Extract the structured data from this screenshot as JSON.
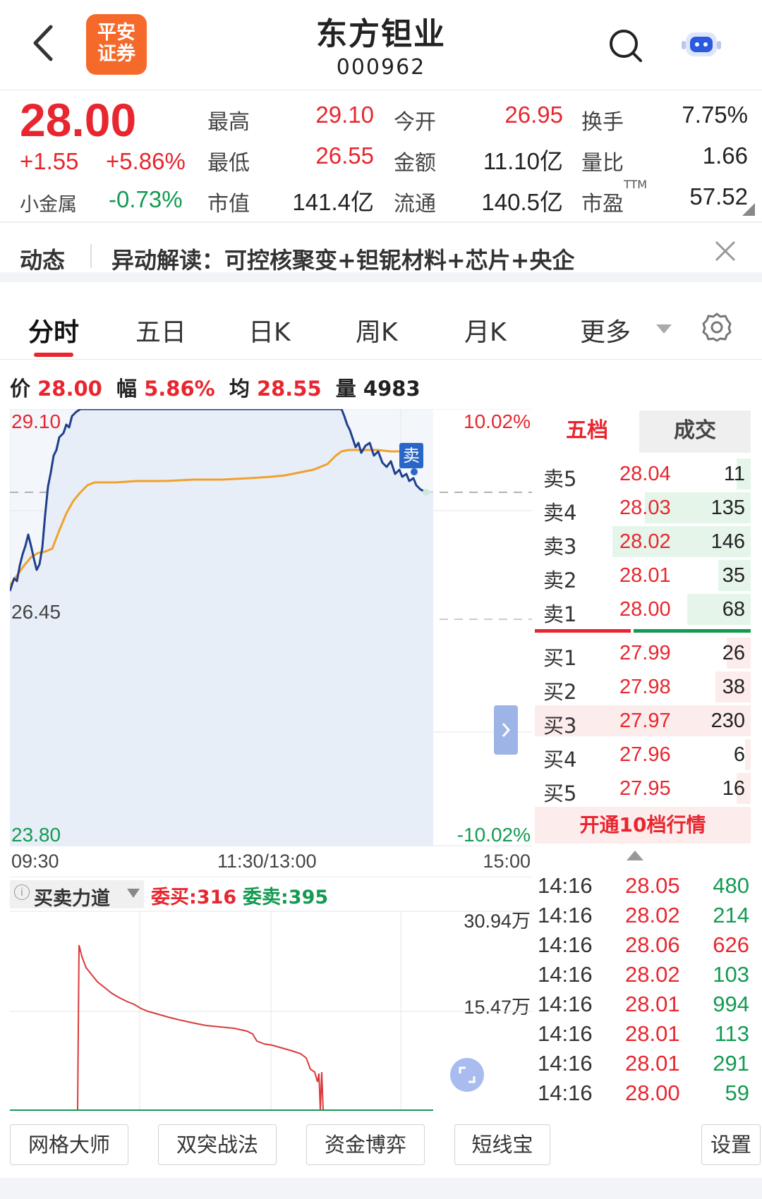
{
  "header": {
    "title": "东方钽业",
    "code": "000962",
    "logo_text_line1": "平安",
    "logo_text_line2": "证券"
  },
  "quote": {
    "price": "28.00",
    "change": "+1.55",
    "change_pct": "+5.86%",
    "sector_name": "小金属",
    "sector_pct": "-0.73%",
    "fields": [
      {
        "label": "最高",
        "value": "29.10"
      },
      {
        "label": "最低",
        "value": "26.55"
      },
      {
        "label": "市值",
        "value": "141.4亿"
      },
      {
        "label": "今开",
        "value": "26.95"
      },
      {
        "label": "金额",
        "value": "11.10亿"
      },
      {
        "label": "流通",
        "value": "140.5亿"
      },
      {
        "label": "换手",
        "value": "7.75%"
      },
      {
        "label": "量比",
        "value": "1.66"
      },
      {
        "label": "市盈",
        "value": "57.52",
        "superscript": "TTM"
      }
    ]
  },
  "news": {
    "tag": "动态",
    "text": "异动解读：可控核聚变+钽铌材料+芯片+央企"
  },
  "tabs": [
    "分时",
    "五日",
    "日K",
    "周K",
    "月K",
    "更多"
  ],
  "active_tab": 0,
  "info_line": {
    "price_label": "价",
    "price": "28.00",
    "amp_label": "幅",
    "amp": "5.86%",
    "avg_label": "均",
    "avg": "28.55",
    "vol_label": "量",
    "vol": "4983"
  },
  "chart_labels": {
    "top_price": "29.10",
    "mid_price": "26.45",
    "bottom_price": "23.80",
    "top_pct": "10.02%",
    "bottom_pct": "-10.02%",
    "sell_marker": "卖"
  },
  "time_axis": [
    "09:30",
    "11:30/13:00",
    "15:00"
  ],
  "orderbook": {
    "tab_active": "五档",
    "tab_other": "成交",
    "sells": [
      {
        "label": "卖5",
        "price": "28.04",
        "vol": "11"
      },
      {
        "label": "卖4",
        "price": "28.03",
        "vol": "135"
      },
      {
        "label": "卖3",
        "price": "28.02",
        "vol": "146"
      },
      {
        "label": "卖2",
        "price": "28.01",
        "vol": "35"
      },
      {
        "label": "卖1",
        "price": "28.00",
        "vol": "68"
      }
    ],
    "buys": [
      {
        "label": "买1",
        "price": "27.99",
        "vol": "26"
      },
      {
        "label": "买2",
        "price": "27.98",
        "vol": "38"
      },
      {
        "label": "买3",
        "price": "27.97",
        "vol": "230"
      },
      {
        "label": "买4",
        "price": "27.96",
        "vol": "6"
      },
      {
        "label": "买5",
        "price": "27.95",
        "vol": "16"
      }
    ],
    "upgrade": "开通10档行情"
  },
  "lower_panel": {
    "indicator": "买卖力道",
    "bid_label": "委买:316",
    "ask_label": "委卖:395",
    "top_value": "30.94万",
    "mid_value": "15.47万"
  },
  "trades": [
    {
      "time": "14:16",
      "price": "28.05",
      "vol": "480",
      "price_color": "red",
      "vol_color": "green"
    },
    {
      "time": "14:16",
      "price": "28.02",
      "vol": "214",
      "price_color": "red",
      "vol_color": "green"
    },
    {
      "time": "14:16",
      "price": "28.06",
      "vol": "626",
      "price_color": "red",
      "vol_color": "red"
    },
    {
      "time": "14:16",
      "price": "28.02",
      "vol": "103",
      "price_color": "red",
      "vol_color": "green"
    },
    {
      "time": "14:16",
      "price": "28.01",
      "vol": "994",
      "price_color": "red",
      "vol_color": "green"
    },
    {
      "time": "14:16",
      "price": "28.01",
      "vol": "113",
      "price_color": "red",
      "vol_color": "green"
    },
    {
      "time": "14:16",
      "price": "28.01",
      "vol": "291",
      "price_color": "red",
      "vol_color": "green"
    },
    {
      "time": "14:16",
      "price": "28.00",
      "vol": "59",
      "price_color": "red",
      "vol_color": "green"
    }
  ],
  "tools": [
    "网格大师",
    "双突战法",
    "资金博弈",
    "短线宝",
    "设置"
  ],
  "colors": {
    "up": "#e8262f",
    "down": "#149a52",
    "price_line": "#1f3f8c",
    "avg_line": "#f0a12c",
    "accent": "#e8262f"
  }
}
